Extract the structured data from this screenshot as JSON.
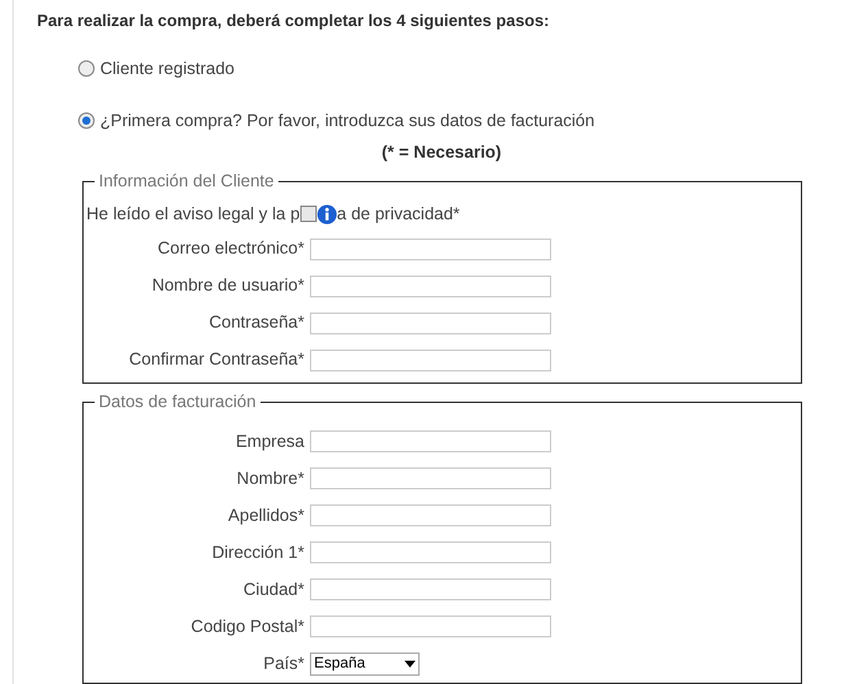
{
  "heading": "Para realizar la compra, deberá completar los 4 siguientes pasos:",
  "options": [
    {
      "label": "Cliente registrado",
      "selected": false
    },
    {
      "label": "¿Primera compra? Por favor, introduzca sus datos de facturación",
      "selected": true
    }
  ],
  "required_note": "(* = Necesario)",
  "client_info": {
    "legend": "Información del Cliente",
    "privacy_before": "He leído el aviso legal y la p",
    "privacy_after": "a de privacidad*",
    "privacy_checked": false,
    "fields": [
      {
        "label": "Correo electrónico*"
      },
      {
        "label": "Nombre de usuario*"
      },
      {
        "label": "Contraseña*"
      },
      {
        "label": "Confirmar Contraseña*"
      }
    ]
  },
  "billing": {
    "legend": "Datos de facturación",
    "fields": [
      {
        "label": "Empresa",
        "kind": "text"
      },
      {
        "label": "Nombre*",
        "kind": "text"
      },
      {
        "label": "Apellidos*",
        "kind": "text"
      },
      {
        "label": "Dirección 1*",
        "kind": "text"
      },
      {
        "label": "Ciudad*",
        "kind": "text"
      },
      {
        "label": "Codigo Postal*",
        "kind": "text"
      },
      {
        "label": "País*",
        "kind": "select",
        "value": "España"
      }
    ]
  }
}
